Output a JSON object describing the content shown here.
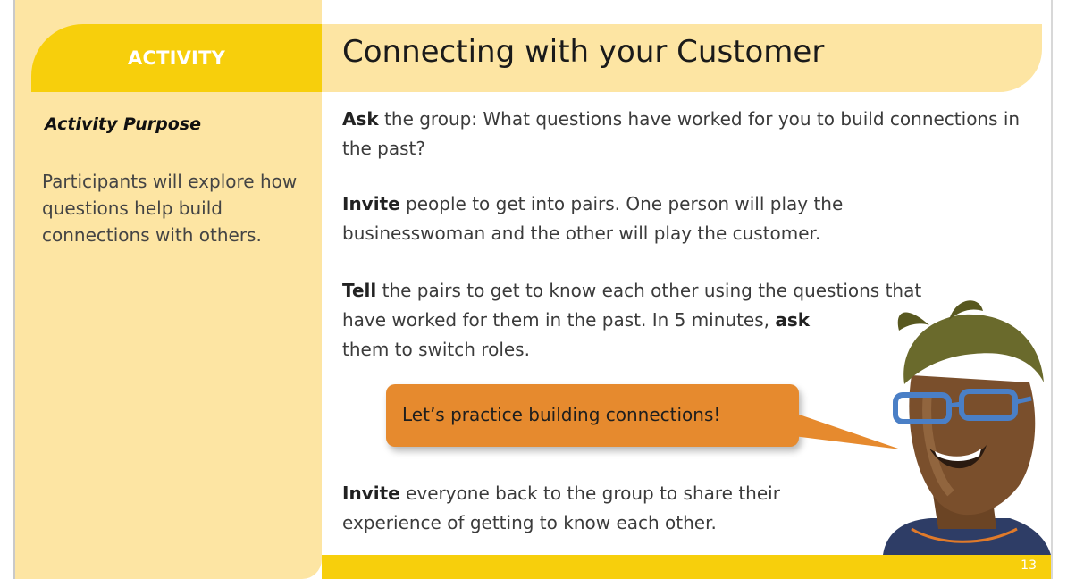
{
  "sidebar": {
    "tab_label": "ACTIVITY",
    "purpose_title": "Activity Purpose",
    "purpose_text": "Participants will explore how questions help build connections with others."
  },
  "main": {
    "title": "Connecting with your Customer",
    "para1": {
      "bold": "Ask",
      "text": " the group: What questions have worked for you to build connections in the past?"
    },
    "para2": {
      "bold": "Invite",
      "text": " people to get into pairs. One person will play the businesswoman and the other will play the customer."
    },
    "para3": {
      "bold1": "Tell",
      "text1": " the pairs to get to know each other using the questions that",
      "text2": "have worked for them in the past. In 5 minutes, ",
      "bold2": "ask",
      "text3": "them to switch roles."
    },
    "bubble_text": "Let’s practice building connections!",
    "para4": {
      "bold": "Invite",
      "text": " everyone back to the group to share their experience of getting to know each other."
    }
  },
  "footer": {
    "page_number": "13"
  },
  "colors": {
    "yellow": "#f7cf0c",
    "light_yellow": "#fde5a3",
    "orange": "#e68a2e"
  },
  "icons": {
    "illustration": "woman-with-headscarf-illustration"
  }
}
